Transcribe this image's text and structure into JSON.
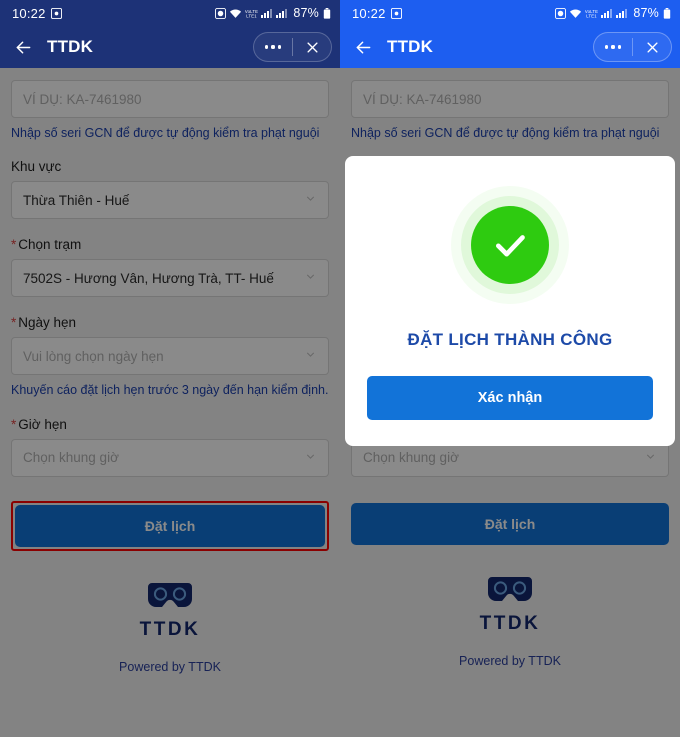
{
  "statusbar": {
    "time": "10:22",
    "battery_percent": "87%",
    "icons": [
      "screenshot-icon",
      "alarm-icon",
      "wifi-icon",
      "volte-icon",
      "signal-sim1-icon",
      "signal-sim2-icon",
      "battery-icon"
    ]
  },
  "appbar": {
    "title": "TTDK",
    "back_icon": "back-arrow-icon",
    "more_icon": "more-options-icon",
    "close_icon": "close-icon"
  },
  "form": {
    "serial_placeholder": "VÍ DỤ: KA-7461980",
    "serial_hint": "Nhập số seri GCN để được tự động kiểm tra phạt nguội",
    "area_label": "Khu vực",
    "area_value": "Thừa Thiên - Huế",
    "station_label": "Chọn trạm",
    "station_value": "7502S - Hương Vân, Hương Trà, TT- Huế",
    "date_label": "Ngày hẹn",
    "date_placeholder": "Vui lòng chọn ngày hẹn",
    "date_hint": "Khuyến cáo đặt lịch hẹn trước 3 ngày đến hạn kiểm định.",
    "time_label": "Giờ hẹn",
    "time_placeholder": "Chọn khung giờ",
    "required_mark": "*",
    "submit_label": "Đặt lịch"
  },
  "brand": {
    "name": "TTDK",
    "powered": "Powered by TTDK",
    "logo_icon": "ttdk-goggles-logo"
  },
  "modal": {
    "title": "ĐẶT LỊCH THÀNH CÔNG",
    "confirm_label": "Xác nhận",
    "success_icon": "check-circle-icon"
  },
  "colors": {
    "header_left": "#1d3277",
    "header_right": "#1d5ef0",
    "primary_button": "#1273d8",
    "success_green": "#2ecb10",
    "highlight_red": "#ff0000",
    "link_blue": "#1b3fae"
  }
}
